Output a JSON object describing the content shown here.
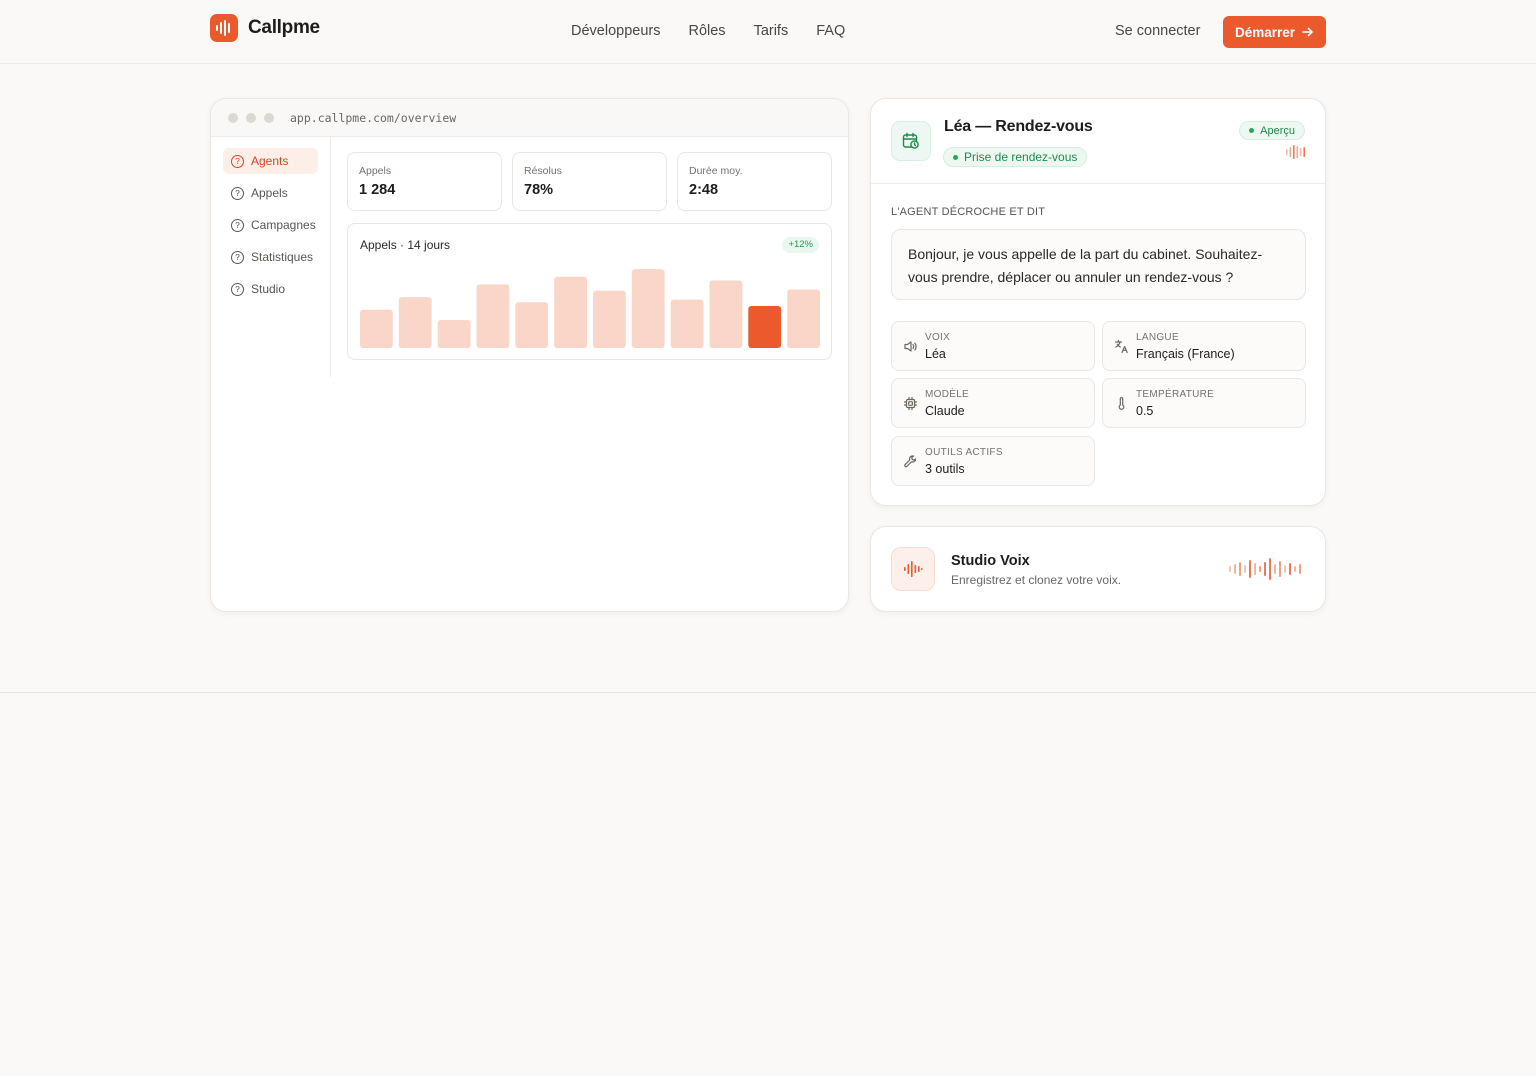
{
  "brand": {
    "name": "Callpme",
    "accent": "#ea5a2d"
  },
  "nav": {
    "links": [
      "Développeurs",
      "Rôles",
      "Tarifs",
      "FAQ"
    ],
    "login": "Se connecter",
    "cta": "Démarrer"
  },
  "dashboard": {
    "url": "app.callpme.com/overview",
    "sidebar": [
      {
        "label": "Agents",
        "active": true
      },
      {
        "label": "Appels",
        "active": false
      },
      {
        "label": "Campagnes",
        "active": false
      },
      {
        "label": "Statistiques",
        "active": false
      },
      {
        "label": "Studio",
        "active": false
      }
    ],
    "stats": [
      {
        "label": "Appels",
        "value": "1 284"
      },
      {
        "label": "Résolus",
        "value": "78%"
      },
      {
        "label": "Durée moy.",
        "value": "2:48"
      }
    ],
    "chart": {
      "title": "Appels · 14 jours",
      "badge": "+12%"
    }
  },
  "chart_data": {
    "type": "bar",
    "title": "Appels · 14 jours",
    "values": [
      30,
      40,
      22,
      50,
      36,
      56,
      45,
      62,
      38,
      53,
      33,
      46
    ],
    "highlight_index": 10,
    "colors": {
      "bar": "#fad6c9",
      "highlight": "#ea5a2d"
    }
  },
  "agent": {
    "title": "Léa — Rendez-vous",
    "type": "Prise de rendez-vous",
    "status": "Aperçu",
    "section_label": "L'AGENT DÉCROCHE ET DIT",
    "greeting": "Bonjour, je vous appelle de la part du cabinet. Souhaitez-vous prendre, déplacer ou annuler un rendez-vous ?",
    "fields": [
      {
        "label": "VOIX",
        "value": "Léa",
        "icon": "speaker-icon"
      },
      {
        "label": "LANGUE",
        "value": "Français (France)",
        "icon": "translate-icon"
      },
      {
        "label": "MODÈLE",
        "value": "Claude",
        "icon": "chip-icon"
      },
      {
        "label": "TEMPÉRATURE",
        "value": "0.5",
        "icon": "thermometer-icon"
      },
      {
        "label": "OUTILS ACTIFS",
        "value": "3 outils",
        "icon": "wrench-icon"
      }
    ]
  },
  "studio": {
    "title": "Studio Voix",
    "subtitle": "Enregistrez et clonez votre voix."
  }
}
